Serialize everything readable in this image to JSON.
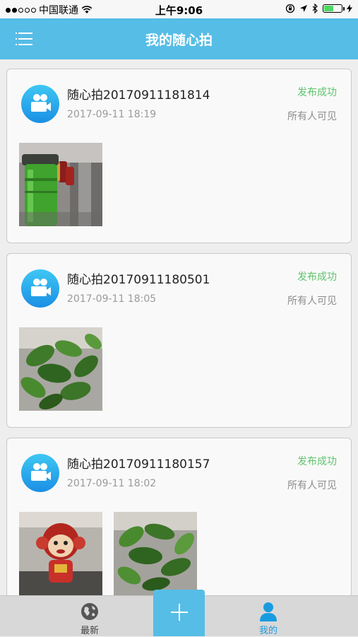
{
  "status_bar": {
    "carrier": "中国联通",
    "time": "上午9:06",
    "battery_level": 0.55
  },
  "header": {
    "title": "我的随心拍"
  },
  "posts": [
    {
      "title": "随心拍20170911181814",
      "time": "2017-09-11 18:19",
      "status": "发布成功",
      "visibility": "所有人可见",
      "photos": [
        "green-water-bottle"
      ]
    },
    {
      "title": "随心拍20170911180501",
      "time": "2017-09-11 18:05",
      "status": "发布成功",
      "visibility": "所有人可见",
      "photos": [
        "potted-plant"
      ]
    },
    {
      "title": "随心拍20170911180157",
      "time": "2017-09-11 18:02",
      "status": "发布成功",
      "visibility": "所有人可见",
      "photos": [
        "monkey-plush-toy",
        "potted-plant"
      ]
    }
  ],
  "tab_bar": {
    "latest_label": "最新",
    "mine_label": "我的",
    "active_color": "#1a9be0",
    "inactive_color": "#444444"
  },
  "colors": {
    "brand": "#56bde6",
    "success": "#5fc46d"
  }
}
